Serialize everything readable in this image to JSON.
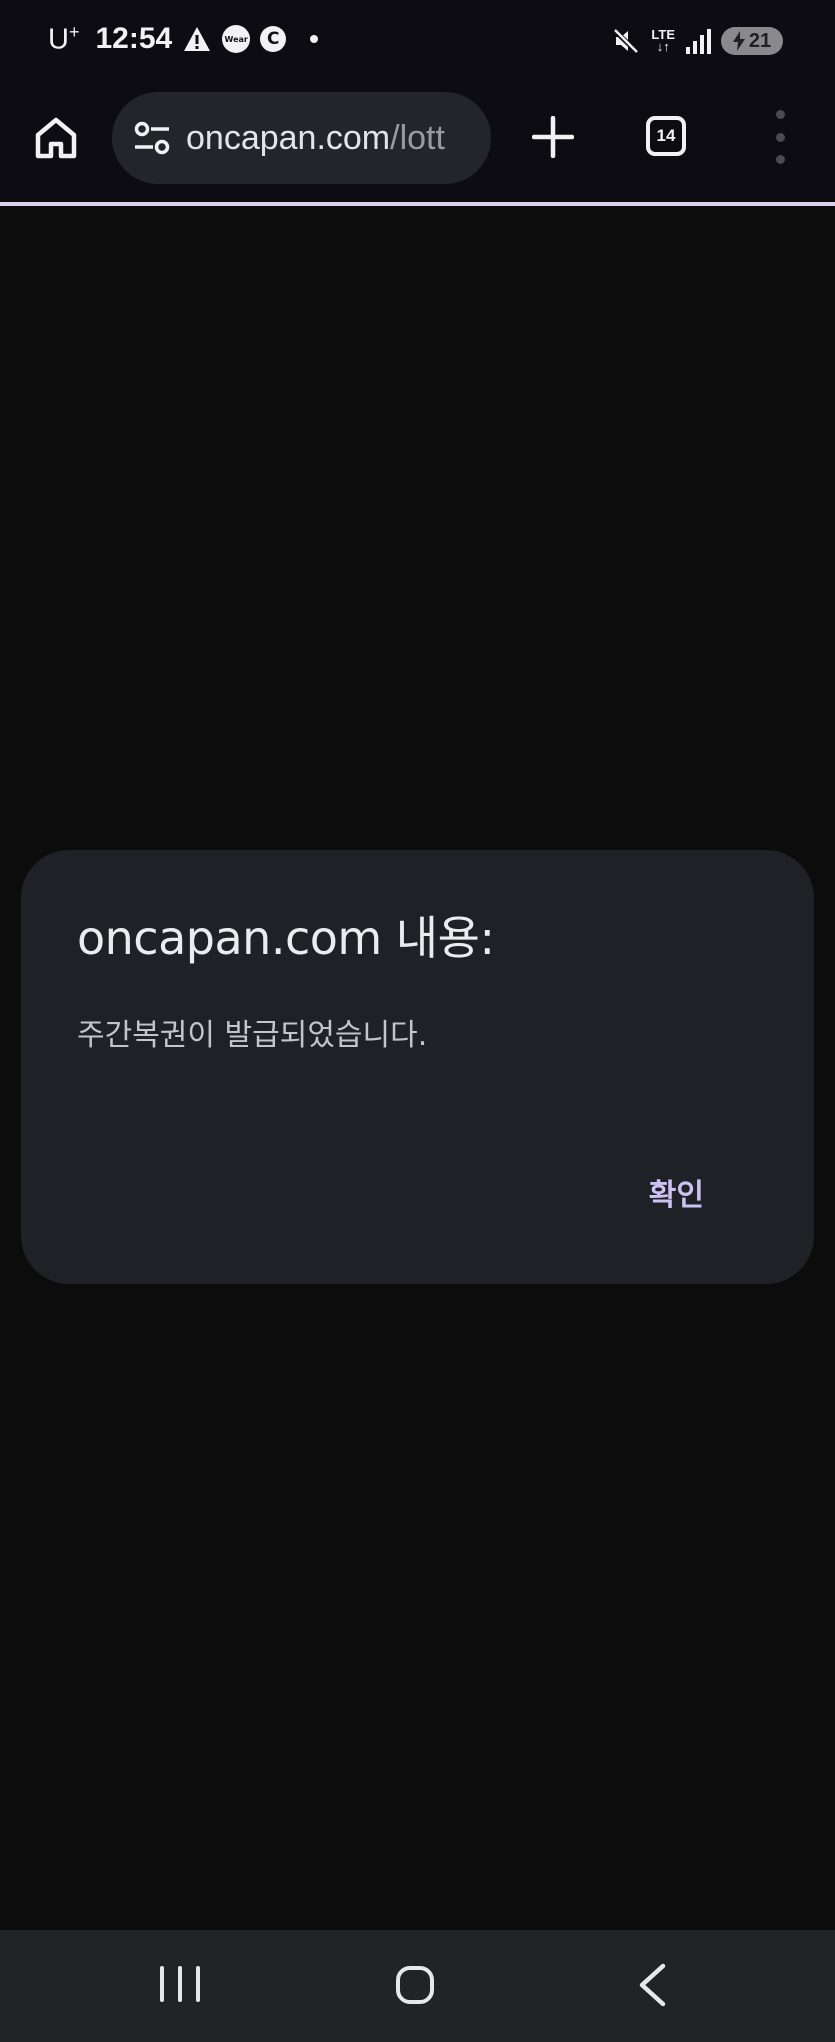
{
  "status_bar": {
    "carrier": "U",
    "carrier_sup": "+",
    "time": "12:54",
    "wear_label": "Wear",
    "c_label": "C",
    "network": "LTE",
    "battery": "21"
  },
  "browser": {
    "url_domain": "oncapan.com",
    "url_path": "/lott",
    "tab_count": "14",
    "icons": [
      "home-icon",
      "tune-icon",
      "plus-icon",
      "tab-switcher-icon",
      "more-vert-icon"
    ]
  },
  "dialog": {
    "title": "oncapan.com 내용:",
    "message": "주간복권이 발급되었습니다.",
    "ok_label": "확인"
  },
  "navbar": {
    "icons": [
      "recents-icon",
      "home-icon",
      "back-icon"
    ]
  },
  "colors": {
    "background": "#0c0c0d",
    "dialog_bg": "#202127",
    "accent": "#cdc2f4"
  }
}
